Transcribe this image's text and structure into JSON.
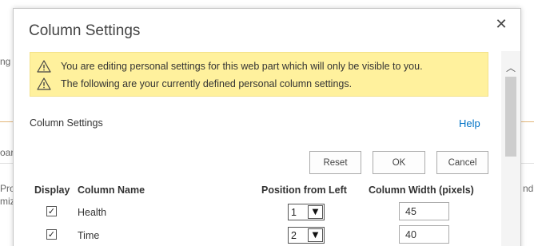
{
  "background": {
    "fragments": [
      "ng",
      "oard",
      "Projec",
      "mize",
      "nd"
    ]
  },
  "dialog": {
    "title": "Column Settings",
    "close_glyph": "✕"
  },
  "warning": {
    "line1": "You are editing personal settings for this web part which will only be visible to you.",
    "line2": "The following are your currently defined personal column settings."
  },
  "section": {
    "label": "Column Settings",
    "help": "Help"
  },
  "buttons": {
    "reset": "Reset",
    "ok": "OK",
    "cancel": "Cancel"
  },
  "table": {
    "headers": {
      "display": "Display",
      "name": "Column Name",
      "position": "Position from Left",
      "width": "Column Width (pixels)"
    },
    "rows": [
      {
        "checked": true,
        "name": "Health",
        "position": "1",
        "width": "45"
      },
      {
        "checked": true,
        "name": "Time",
        "position": "2",
        "width": "40"
      }
    ]
  },
  "icons": {
    "warning": "warning-triangle-icon",
    "close": "close-icon",
    "scroll_up": "chevron-up-icon",
    "dropdown": "chevron-down-icon",
    "check": "checkmark-icon"
  },
  "colors": {
    "warning_bg": "#fff19d",
    "link": "#0072c6"
  }
}
